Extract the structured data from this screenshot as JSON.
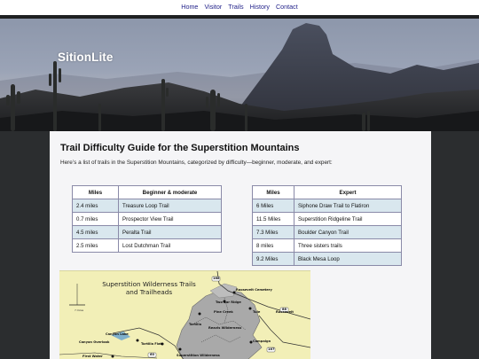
{
  "nav": {
    "items": [
      "Home",
      "Visitor",
      "Trails",
      "History",
      "Contact"
    ]
  },
  "hero": {
    "site_title": "SitionLite"
  },
  "main": {
    "title": "Trail Difficulty Guide for the Superstition Mountains",
    "intro": "Here’s a list of trails in the Superstition Mountains, categorized by difficulty—beginner, moderate, and expert:"
  },
  "tables": {
    "left": {
      "headers": [
        "Miles",
        "Beginner & moderate"
      ],
      "rows": [
        [
          "2.4 miles",
          "Treasure Loop Trail"
        ],
        [
          "0.7 miles",
          "Prospector View Trail"
        ],
        [
          "4.5 miles",
          "Peralta Trail"
        ],
        [
          "2.5 miles",
          "Lost Dutchman Trail"
        ]
      ]
    },
    "right": {
      "headers": [
        "Miles",
        "Expert"
      ],
      "rows": [
        [
          "6 Miles",
          "Siphone Draw Trail to Flatiron"
        ],
        [
          "11.5 Miles",
          "Superstition Ridgeline Trail"
        ],
        [
          "7.3 Miles",
          "Boulder Canyon Trail"
        ],
        [
          "8 miles",
          "Three sisters trails"
        ],
        [
          "9.2 Miles",
          "Black Mesa Loop"
        ]
      ]
    }
  },
  "map": {
    "title": "Superstition Wilderness Trails and Trailheads",
    "scale_label": "7 miles",
    "labels": {
      "roosevelt_cemetery": "Roosevelt Cemetery",
      "roosevelt": "Roosevelt",
      "two_bar_ridge": "Two Bar Ridge",
      "pine_creek": "Pine Creek",
      "tule": "Tule",
      "reavis_wilderness": "Reavis Wilderness",
      "tortilla": "Tortilla",
      "campaign": "Campaign",
      "canyon_lake": "Canyon Lake",
      "canyon_overlook": "Canyon Overlook",
      "tortilla_flat": "Tortilla Flat",
      "first_water": "First Water",
      "superstition_wilderness": "Superstition Wilderness"
    },
    "route_numbers": [
      "188",
      "88",
      "60",
      "187"
    ]
  },
  "colors": {
    "page_bg": "#2b2d2f",
    "content_bg": "#f5f5f7",
    "nav_link": "#23238a",
    "table_row_shade": "#d9e7ee",
    "map_bg": "#f2efb7",
    "wilderness_fill": "#a9a9a9"
  }
}
